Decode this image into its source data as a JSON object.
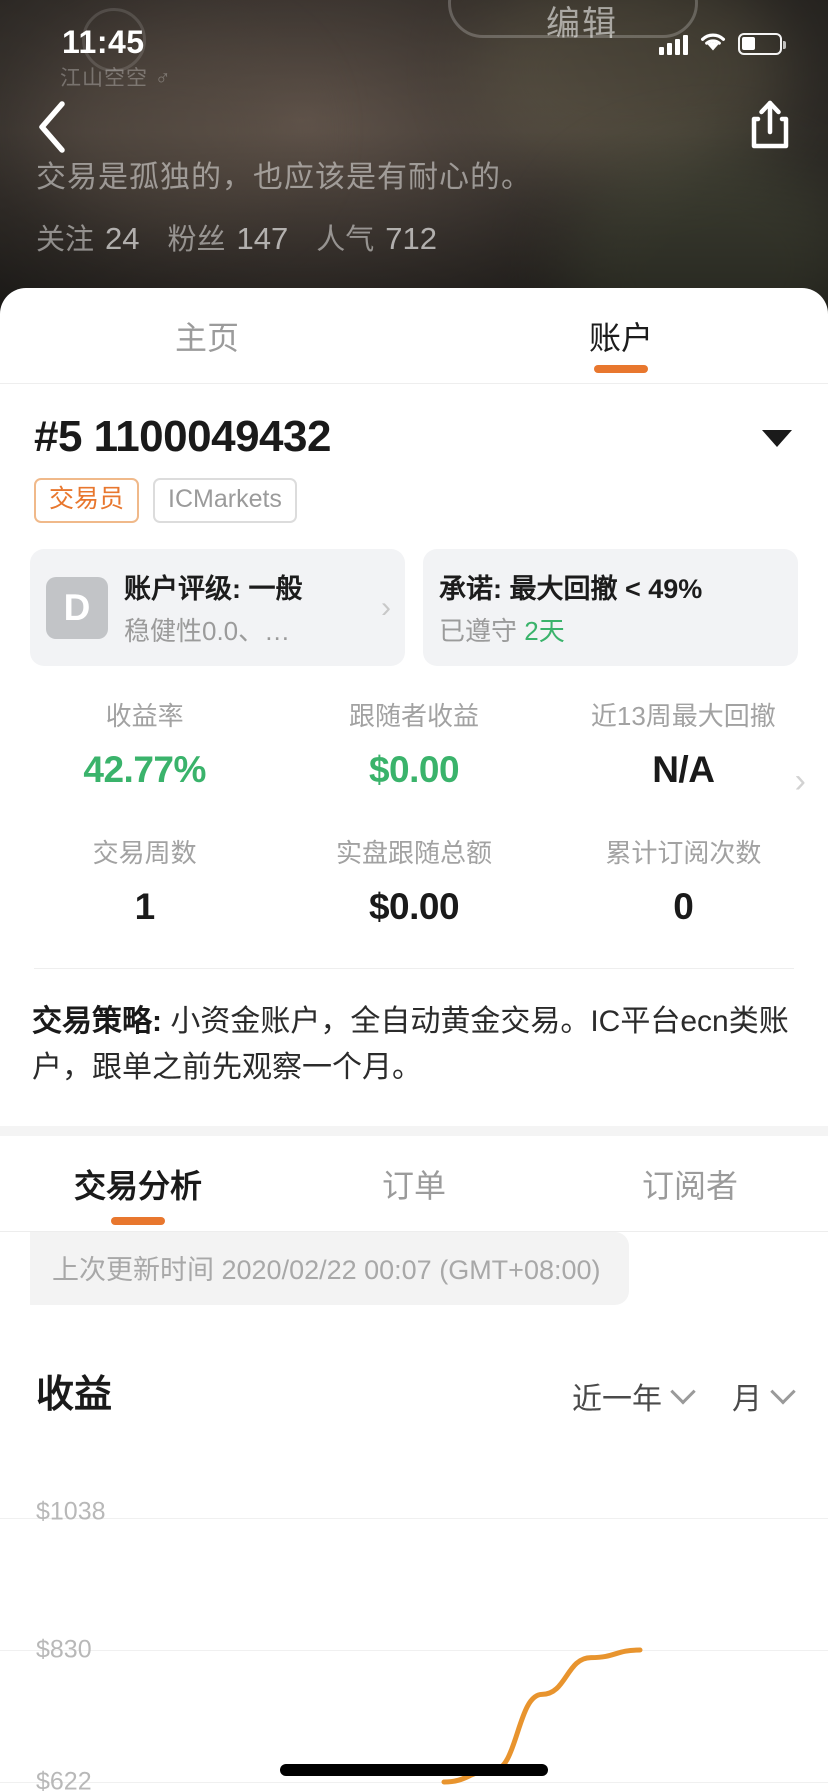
{
  "status_bar": {
    "time": "11:45",
    "signal_icon": "cellular-signal-icon",
    "wifi_icon": "wifi-icon",
    "battery_icon": "battery-icon"
  },
  "hero": {
    "edit_label": "编辑",
    "nickname": "江山空空 ♂",
    "quote": "交易是孤独的，也应该是有耐心的。",
    "stats": [
      {
        "label": "关注",
        "value": "24"
      },
      {
        "label": "粉丝",
        "value": "147"
      },
      {
        "label": "人气",
        "value": "712"
      }
    ],
    "back_icon": "back-chevron-icon",
    "share_icon": "share-icon"
  },
  "main_tabs": [
    {
      "label": "主页",
      "active": false
    },
    {
      "label": "账户",
      "active": true
    }
  ],
  "account": {
    "number": "#5 1100049432",
    "dropdown_icon": "caret-down-icon",
    "badges": [
      {
        "label": "交易员",
        "type": "trader",
        "color": "#e8772e"
      },
      {
        "label": "ICMarkets",
        "type": "broker",
        "color": "#9b9b9b"
      }
    ],
    "cards": [
      {
        "grade": "D",
        "line1": "账户评级: 一般",
        "line2_prefix": "稳健性0.0、…",
        "line2_green": "",
        "chevron": "chevron-right-icon"
      },
      {
        "grade": "",
        "line1": "承诺: 最大回撤 < 49%",
        "line2_prefix": "已遵守 ",
        "line2_green": "2天",
        "chevron": ""
      }
    ]
  },
  "stats_rows": [
    {
      "has_chevron": true,
      "cells": [
        {
          "label": "收益率",
          "value": "42.77%",
          "color": "green"
        },
        {
          "label": "跟随者收益",
          "value": "$0.00",
          "color": "green"
        },
        {
          "label": "近13周最大回撤",
          "value": "N/A",
          "color": "black"
        }
      ]
    },
    {
      "has_chevron": false,
      "cells": [
        {
          "label": "交易周数",
          "value": "1",
          "color": "black"
        },
        {
          "label": "实盘跟随总额",
          "value": "$0.00",
          "color": "black"
        },
        {
          "label": "累计订阅次数",
          "value": "0",
          "color": "black"
        }
      ]
    }
  ],
  "strategy": {
    "label": "交易策略:",
    "text": " 小资金账户，全自动黄金交易。IC平台ecn类账户，跟单之前先观察一个月。"
  },
  "sub_tabs": [
    {
      "label": "交易分析",
      "active": true
    },
    {
      "label": "订单",
      "active": false
    },
    {
      "label": "订阅者",
      "active": false
    }
  ],
  "update_bar": {
    "text": "上次更新时间 2020/02/22 00:07 (GMT+08:00)"
  },
  "chart_section": {
    "title": "收益",
    "range_select": "近一年",
    "period_select": "月"
  },
  "chart_data": {
    "type": "line",
    "title": "收益",
    "xlabel": "",
    "ylabel": "",
    "ytick_labels": [
      "$1038",
      "$830",
      "$622"
    ],
    "ytick_values": [
      1038,
      830,
      622
    ],
    "ylim": [
      622,
      1038
    ],
    "grid": true,
    "legend": "none",
    "line_color": "#e8942e",
    "series": [
      {
        "name": "收益",
        "x": [
          0,
          1,
          2,
          3,
          4,
          5,
          6,
          7,
          8,
          9,
          10
        ],
        "values": [
          622,
          622,
          622,
          622,
          622,
          622,
          622,
          640,
          760,
          818,
          830
        ]
      }
    ]
  },
  "accent_colors": {
    "orange": "#e8772e",
    "green": "#3ab36b",
    "chart_line": "#e8942e",
    "muted": "#9b9b9b"
  }
}
